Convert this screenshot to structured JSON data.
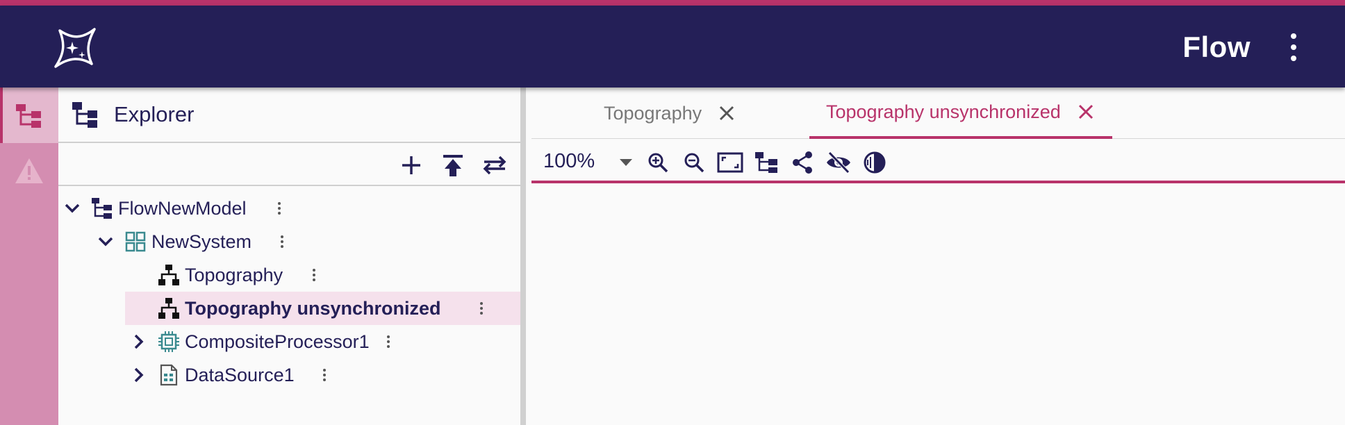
{
  "colors": {
    "appbar": "#241f57",
    "accent": "#b8336a",
    "rail": "#d48db1",
    "selected_row": "#f5e1ec",
    "text": "#241f57"
  },
  "appbar": {
    "title": "Flow",
    "logo_icon": "sparkle-star-logo",
    "menu_icon": "more-vert-icon"
  },
  "rail": {
    "items": [
      {
        "icon": "tree-hierarchy-icon",
        "active": true
      },
      {
        "icon": "warning-icon",
        "active": false
      }
    ]
  },
  "explorer": {
    "title": "Explorer",
    "toolbar": {
      "icons": [
        "add-icon",
        "upload-to-top-icon",
        "swap-icon"
      ]
    },
    "tree": [
      {
        "label": "FlowNewModel",
        "icon": "model-tree-icon",
        "expanded": true,
        "level": 0
      },
      {
        "label": "NewSystem",
        "icon": "system-grid-icon",
        "expanded": true,
        "level": 1
      },
      {
        "label": "Topography",
        "icon": "topography-icon",
        "level": 2
      },
      {
        "label": "Topography unsynchronized",
        "icon": "topography-icon",
        "level": 2,
        "selected": true
      },
      {
        "label": "CompositeProcessor1",
        "icon": "processor-chip-icon",
        "expanded": false,
        "level": 2
      },
      {
        "label": "DataSource1",
        "icon": "datasource-file-icon",
        "expanded": false,
        "level": 2
      }
    ]
  },
  "editor": {
    "tabs": [
      {
        "label": "Topography",
        "active": false
      },
      {
        "label": "Topography unsynchronized",
        "active": true
      }
    ],
    "toolbar": {
      "zoom": "100%",
      "icons": [
        "zoom-in-icon",
        "zoom-out-icon",
        "fit-screen-icon",
        "tree-layout-icon",
        "share-icon",
        "visibility-off-icon",
        "contrast-icon"
      ]
    }
  }
}
